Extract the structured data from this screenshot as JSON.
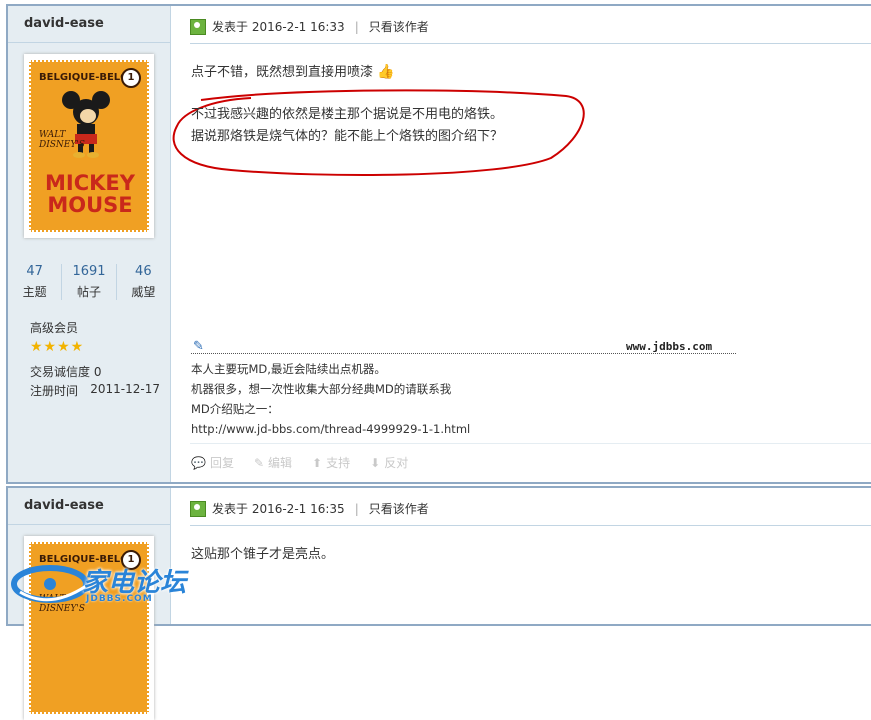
{
  "colors": {
    "accent": "#336699",
    "border": "#c2d5e3",
    "sidebar_bg": "#e5edf2",
    "annotation": "#cc0000"
  },
  "posts": [
    {
      "author": "david-ease",
      "avatar": {
        "top": "BELGIQUE-BELGIE",
        "number": "1",
        "walt": "WALT\nDISNEY'S",
        "title": "MICKEY\nMOUSE"
      },
      "stats": [
        {
          "value": "47",
          "label": "主题"
        },
        {
          "value": "1691",
          "label": "帖子"
        },
        {
          "value": "46",
          "label": "威望"
        }
      ],
      "group": "高级会员",
      "stars": "★★★★",
      "credit": "交易诚信度 0",
      "reg_label": "注册时间",
      "reg_date": "2011-12-17",
      "posted": "发表于 2016-2-1 16:33",
      "only_author": "只看该作者",
      "content": [
        "点子不错，既然想到直接用喷漆",
        "不过我感兴趣的依然是楼主那个据说是不用电的烙铁。",
        "据说那烙铁是烧气体的？能不能上个烙铁的图介绍下？"
      ],
      "signature_url": "www.jdbbs.com",
      "signature": [
        "本人主要玩MD,最近会陆续出点机器。",
        "机器很多，想一次性收集大部分经典MD的请联系我",
        "MD介绍贴之一：",
        "http://www.jd-bbs.com/thread-4999929-1-1.html"
      ],
      "actions": [
        "回复",
        "编辑",
        "支持",
        "反对"
      ]
    },
    {
      "author": "david-ease",
      "posted": "发表于 2016-2-1 16:35",
      "only_author": "只看该作者",
      "content": [
        "这贴那个锥子才是亮点。"
      ]
    }
  ],
  "watermark": {
    "name": "家电论坛",
    "domain": "JDBBS.COM"
  }
}
